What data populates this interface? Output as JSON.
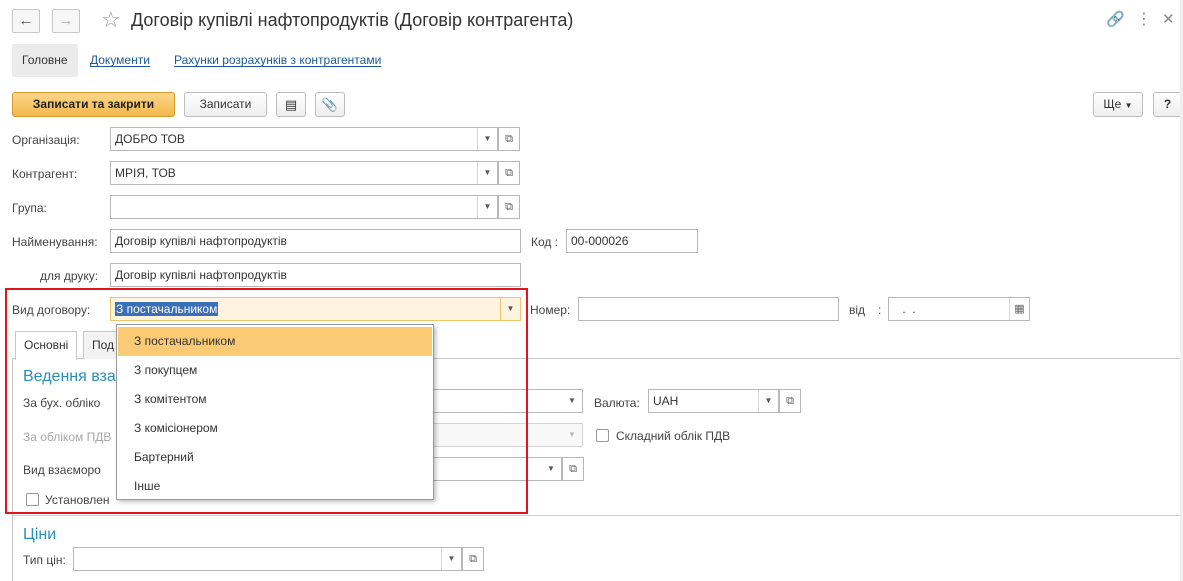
{
  "window": {
    "title": "Договір купівлі нафтопродуктів (Договір контрагента)",
    "icons": [
      "arrow-left-icon",
      "arrow-right-icon",
      "star-icon",
      "link-icon",
      "more-vertical-icon",
      "close-icon"
    ]
  },
  "nav_tabs": [
    {
      "label": "Головне",
      "active": true
    },
    {
      "label": "Документи",
      "active": false
    },
    {
      "label": "Рахунки розрахунків з контрагентами",
      "active": false
    }
  ],
  "toolbar": {
    "save_close": "Записати та закрити",
    "save": "Записати",
    "more": "Ще",
    "help": "?"
  },
  "form": {
    "organization": {
      "label": "Організація:",
      "value": "ДОБРО ТОВ"
    },
    "counterparty": {
      "label": "Контрагент:",
      "value": "МРІЯ, ТОВ"
    },
    "group": {
      "label": "Група:",
      "value": ""
    },
    "name": {
      "label": "Найменування:",
      "value": "Договір купівлі нафтопродуктів"
    },
    "code": {
      "label": "Код :",
      "value": "00-000026"
    },
    "print_name": {
      "label": "для друку:",
      "value": "Договір купівлі нафтопродуктів"
    },
    "contract_type": {
      "label": "Вид договору:",
      "value": "З постачальником"
    },
    "number": {
      "label": "Номер:",
      "value": ""
    },
    "date": {
      "label": "від",
      "colon": ":",
      "value": " .  ."
    }
  },
  "dropdown": {
    "options": [
      "З постачальником",
      "З покупцем",
      "З комітентом",
      "З комісіонером",
      "Бартерний",
      "Інше"
    ],
    "selected_index": 0
  },
  "tabs": [
    {
      "label": "Основні",
      "active": true
    },
    {
      "label": "Под",
      "active": false
    }
  ],
  "main_tab": {
    "section_title": "Ведення вза",
    "accounting_label": "За бух. обліко",
    "vat_label": "За обліком ПДВ",
    "currency": {
      "label": "Валюта:",
      "value": "UAH"
    },
    "complex_vat": {
      "label": "Складний облік ПДВ",
      "checked": false
    },
    "settlement_label": "Вид взаєморо",
    "established_label": "Установлен"
  },
  "prices": {
    "section_title": "Ціни",
    "price_type": {
      "label": "Тип цін:",
      "value": ""
    }
  }
}
